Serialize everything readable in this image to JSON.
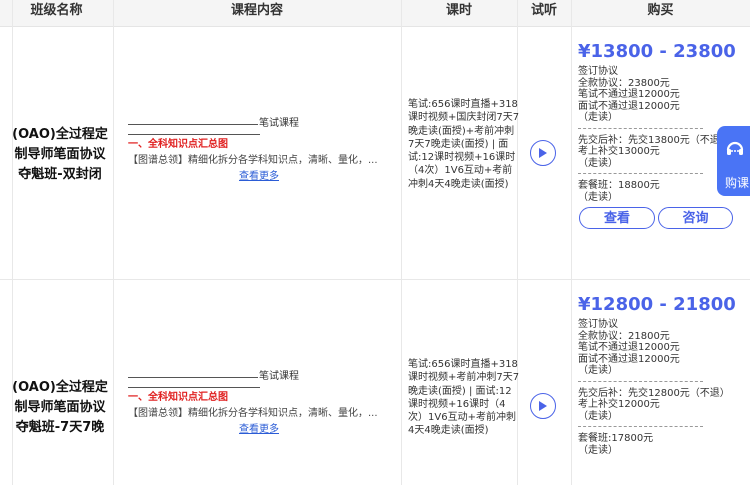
{
  "headers": {
    "class_name": "班级名称",
    "content": "课程内容",
    "hours": "课时",
    "trial": "试听",
    "buy": "购买"
  },
  "rows": [
    {
      "name_lines": [
        "(OAO)全过程定",
        "制导师笔面协议",
        "夺魁班-双封闭"
      ],
      "content": {
        "title": "笔试课程",
        "red": "一、全科知识点汇总图",
        "desc": "【图谱总领】精细化拆分各学科知识点，清晰、量化，...",
        "more": "查看更多"
      },
      "hours": "笔试:656课时直播+318课时视频+国庆封闭7天7晚走读(面授)+考前冲刺7天7晚走读(面授) | 面试:12课时视频+16课时（4次）1V6互动+考前冲刺4天4晚走读(面授)",
      "buy": {
        "price": "¥13800 - 23800",
        "lines_a": [
          "签订协议",
          "全款协议：23800元",
          "笔试不通过退12000元",
          "面试不通过退12000元",
          "（走读）"
        ],
        "lines_b": [
          "先交后补：先交13800元（不退",
          "考上补交13000元",
          "（走读）"
        ],
        "lines_c": [
          "套餐班：18800元",
          "（走读）"
        ],
        "btn_view": "查看",
        "btn_consult": "咨询"
      }
    },
    {
      "name_lines": [
        "(OAO)全过程定",
        "制导师笔面协议",
        "夺魁班-7天7晚"
      ],
      "content": {
        "title": "笔试课程",
        "red": "一、全科知识点汇总图",
        "desc": "【图谱总领】精细化拆分各学科知识点，清晰、量化，...",
        "more": "查看更多"
      },
      "hours": "笔试:656课时直播+318课时视频+考前冲刺7天7晚走读(面授) | 面试:12课时视频+16课时（4次）1V6互动+考前冲刺4天4晚走读(面授)",
      "buy": {
        "price": "¥12800 - 21800",
        "lines_a": [
          "签订协议",
          "全款协议：21800元",
          "笔试不通过退12000元",
          "面试不通过退12000元",
          "（走读）"
        ],
        "lines_b": [
          "先交后补：先交12800元（不退）",
          "考上补交12000元",
          "（走读）"
        ],
        "lines_c": [
          "套餐班:17800元",
          "（走读）"
        ]
      }
    }
  ],
  "floating": {
    "label": "购课",
    "icon": "headset-icon"
  },
  "colors": {
    "accent": "#4a63e8",
    "red": "#e02020",
    "link": "#2b5cd6",
    "float_bg": "#4a74f5"
  }
}
